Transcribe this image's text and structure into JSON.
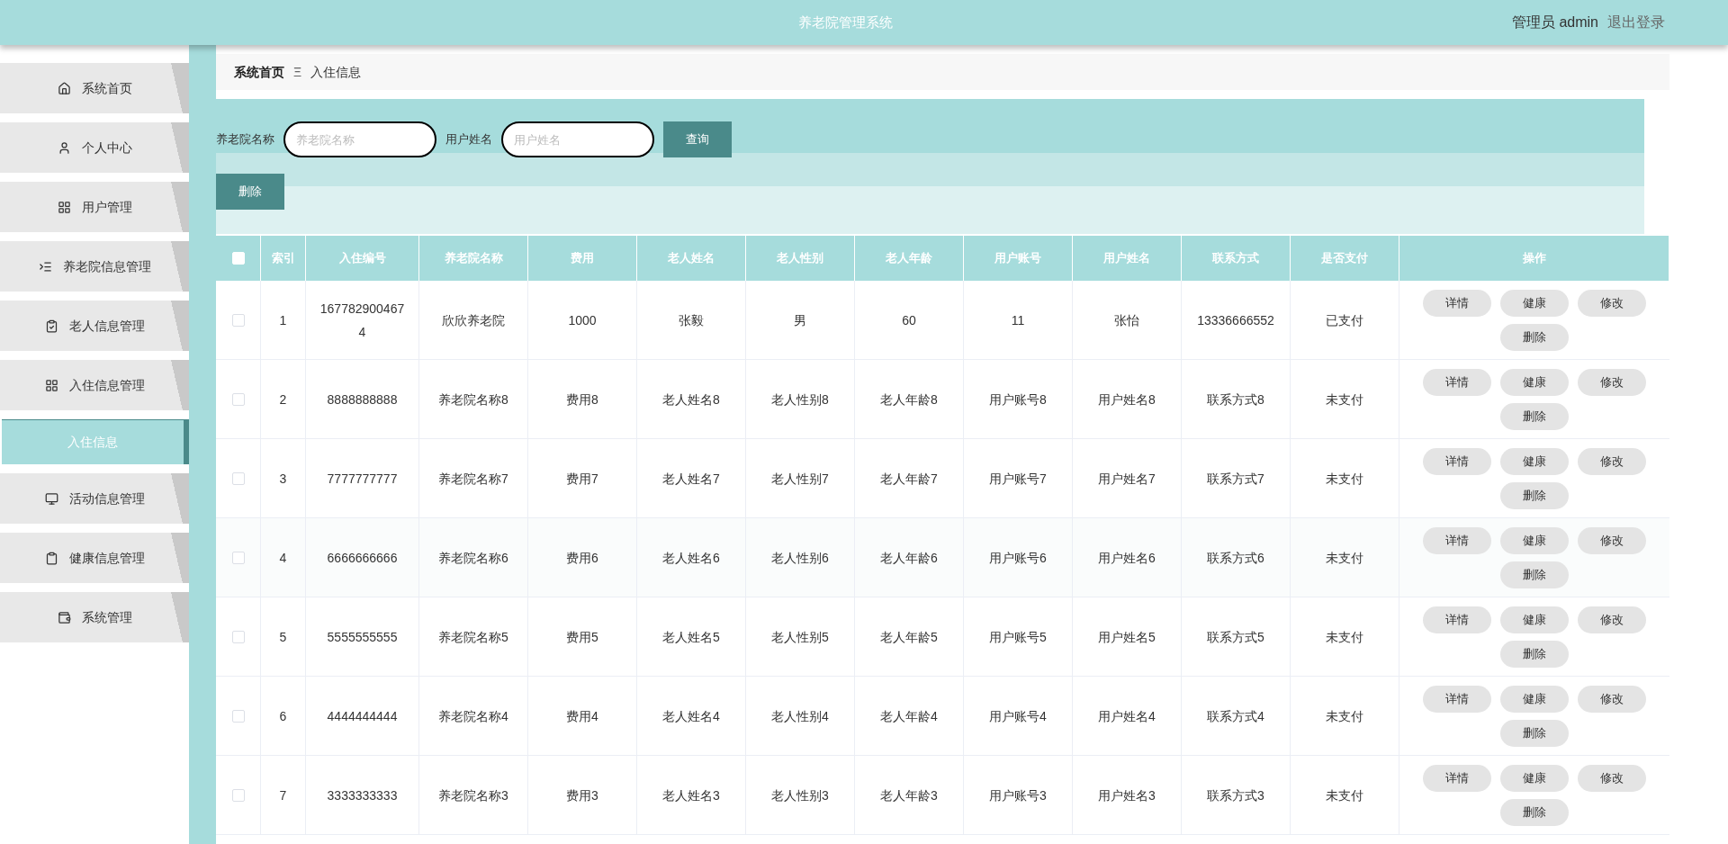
{
  "header": {
    "title": "养老院管理系统",
    "user": "管理员 admin",
    "logout": "退出登录"
  },
  "sidebar": {
    "items": [
      {
        "label": "系统首页"
      },
      {
        "label": "个人中心"
      },
      {
        "label": "用户管理"
      },
      {
        "label": "养老院信息管理"
      },
      {
        "label": "老人信息管理"
      },
      {
        "label": "入住信息管理",
        "children": [
          {
            "label": "入住信息",
            "selected": true
          }
        ]
      },
      {
        "label": "活动信息管理"
      },
      {
        "label": "健康信息管理"
      },
      {
        "label": "系统管理"
      }
    ]
  },
  "breadcrumb": {
    "home": "系统首页",
    "separator": "Ξ",
    "current": "入住信息"
  },
  "search": {
    "fields": [
      {
        "label": "养老院名称",
        "placeholder": "养老院名称"
      },
      {
        "label": "用户姓名",
        "placeholder": "用户姓名"
      }
    ],
    "button": "查询"
  },
  "delete_button": "删除",
  "table": {
    "select_all_checked": false,
    "columns": [
      "索引",
      "入住编号",
      "养老院名称",
      "费用",
      "老人姓名",
      "老人性别",
      "老人年龄",
      "用户账号",
      "用户姓名",
      "联系方式",
      "是否支付",
      "操作"
    ],
    "rows": [
      {
        "checked": false,
        "cells": [
          "1",
          "1677829004674",
          "欣欣养老院",
          "1000",
          "张毅",
          "男",
          "60",
          "11",
          "张怡",
          "13336666552",
          "已支付"
        ],
        "actions": [
          "详情",
          "健康",
          "修改",
          "删除"
        ]
      },
      {
        "checked": false,
        "cells": [
          "2",
          "8888888888",
          "养老院名称8",
          "费用8",
          "老人姓名8",
          "老人性别8",
          "老人年龄8",
          "用户账号8",
          "用户姓名8",
          "联系方式8",
          "未支付"
        ],
        "actions": [
          "详情",
          "健康",
          "修改",
          "删除"
        ]
      },
      {
        "checked": false,
        "cells": [
          "3",
          "7777777777",
          "养老院名称7",
          "费用7",
          "老人姓名7",
          "老人性别7",
          "老人年龄7",
          "用户账号7",
          "用户姓名7",
          "联系方式7",
          "未支付"
        ],
        "actions": [
          "详情",
          "健康",
          "修改",
          "删除"
        ]
      },
      {
        "checked": false,
        "cells": [
          "4",
          "6666666666",
          "养老院名称6",
          "费用6",
          "老人姓名6",
          "老人性别6",
          "老人年龄6",
          "用户账号6",
          "用户姓名6",
          "联系方式6",
          "未支付"
        ],
        "actions": [
          "详情",
          "健康",
          "修改",
          "删除"
        ]
      },
      {
        "checked": false,
        "cells": [
          "5",
          "5555555555",
          "养老院名称5",
          "费用5",
          "老人姓名5",
          "老人性别5",
          "老人年龄5",
          "用户账号5",
          "用户姓名5",
          "联系方式5",
          "未支付"
        ],
        "actions": [
          "详情",
          "健康",
          "修改",
          "删除"
        ]
      },
      {
        "checked": false,
        "cells": [
          "6",
          "4444444444",
          "养老院名称4",
          "费用4",
          "老人姓名4",
          "老人性别4",
          "老人年龄4",
          "用户账号4",
          "用户姓名4",
          "联系方式4",
          "未支付"
        ],
        "actions": [
          "详情",
          "健康",
          "修改",
          "删除"
        ]
      },
      {
        "checked": false,
        "cells": [
          "7",
          "3333333333",
          "养老院名称3",
          "费用3",
          "老人姓名3",
          "老人性别3",
          "老人年龄3",
          "用户账号3",
          "用户姓名3",
          "联系方式3",
          "未支付"
        ],
        "actions": [
          "详情",
          "健康",
          "修改",
          "删除"
        ]
      }
    ]
  }
}
